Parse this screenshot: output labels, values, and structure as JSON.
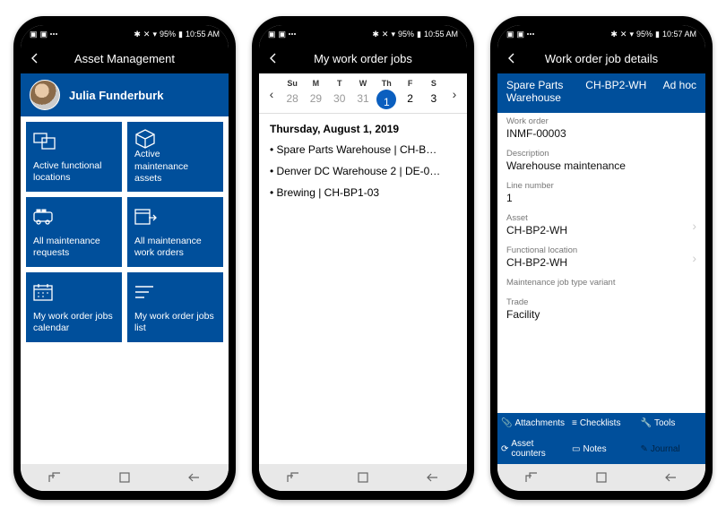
{
  "statusbar": {
    "battery": "95%",
    "time1": "10:55 AM",
    "time3": "10:57 AM"
  },
  "screen1": {
    "title": "Asset Management",
    "user": "Julia Funderburk",
    "tiles": [
      "Active functional locations",
      "Active maintenance assets",
      "All maintenance requests",
      "All maintenance work orders",
      "My work order jobs calendar",
      "My work order jobs list"
    ]
  },
  "screen2": {
    "title": "My work order jobs",
    "dayNames": [
      "Su",
      "M",
      "T",
      "W",
      "Th",
      "F",
      "S"
    ],
    "dayNums": [
      "28",
      "29",
      "30",
      "31",
      "1",
      "2",
      "3"
    ],
    "selectedIdx": 4,
    "dateTitle": "Thursday, August 1, 2019",
    "jobs": [
      "Spare Parts Warehouse | CH-B…",
      "Denver DC Warehouse 2 | DE-0…",
      "Brewing | CH-BP1-03"
    ]
  },
  "screen3": {
    "title": "Work order job details",
    "sub": [
      "Spare Parts Warehouse",
      "CH-BP2-WH",
      "Ad hoc"
    ],
    "fields": [
      {
        "label": "Work order",
        "value": "INMF-00003"
      },
      {
        "label": "Description",
        "value": "Warehouse maintenance"
      },
      {
        "label": "Line number",
        "value": "1"
      },
      {
        "label": "Asset",
        "value": "CH-BP2-WH",
        "chev": true
      },
      {
        "label": "Functional location",
        "value": "CH-BP2-WH",
        "chev": true
      },
      {
        "label": "Maintenance job type variant",
        "value": ""
      },
      {
        "label": "Trade",
        "value": "Facility"
      }
    ],
    "actions": [
      "Attachments",
      "Checklists",
      "Tools",
      "Asset counters",
      "Notes",
      "Journal"
    ]
  }
}
